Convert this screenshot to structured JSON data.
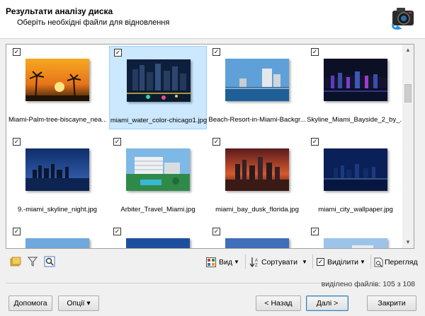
{
  "header": {
    "title": "Результати аналізу диска",
    "subtitle": "Оберіть необхідні файли для відновлення"
  },
  "files": [
    {
      "name": "Miami-Palm-tree-biscayne_nea...",
      "checked": true,
      "selected": false,
      "icon": "sunset-palms-photo"
    },
    {
      "name": "miami_water_color-chicago1.jpg",
      "checked": true,
      "selected": true,
      "icon": "night-skyline-photo"
    },
    {
      "name": "Beach-Resort-in-Miami-Backgr...",
      "checked": true,
      "selected": false,
      "icon": "beach-resort-photo"
    },
    {
      "name": "Skyline_Miami_Bayside_2_by_...",
      "checked": true,
      "selected": false,
      "icon": "night-skyline-photo"
    },
    {
      "name": "9.-miami_skyline_night.jpg",
      "checked": true,
      "selected": false,
      "icon": "night-skyline-photo"
    },
    {
      "name": "Arbiter_Travel_Miami.jpg",
      "checked": true,
      "selected": false,
      "icon": "hotel-photo"
    },
    {
      "name": "miami_bay_dusk_florida.jpg",
      "checked": true,
      "selected": false,
      "icon": "dusk-skyline-photo"
    },
    {
      "name": "miami_city_wallpaper.jpg",
      "checked": true,
      "selected": false,
      "icon": "night-skyline-photo"
    },
    {
      "name": "",
      "checked": true,
      "selected": false,
      "icon": "photo"
    },
    {
      "name": "",
      "checked": true,
      "selected": false,
      "icon": "photo"
    },
    {
      "name": "",
      "checked": true,
      "selected": false,
      "icon": "photo"
    },
    {
      "name": "",
      "checked": true,
      "selected": false,
      "icon": "photo"
    }
  ],
  "toolbar": {
    "view_label": "Вид",
    "sort_label": "Сортувати",
    "select_label": "Виділити",
    "preview_label": "Перегляд"
  },
  "status": {
    "selected_text": "виділено файлів: 105 з 108"
  },
  "buttons": {
    "help": "Допомога",
    "options": "Опції ▾",
    "back": "< Назад",
    "next": "Далі >",
    "close": "Закрити"
  },
  "colors": {
    "selection": "#cce8ff",
    "selection_border": "#99d1ff"
  }
}
